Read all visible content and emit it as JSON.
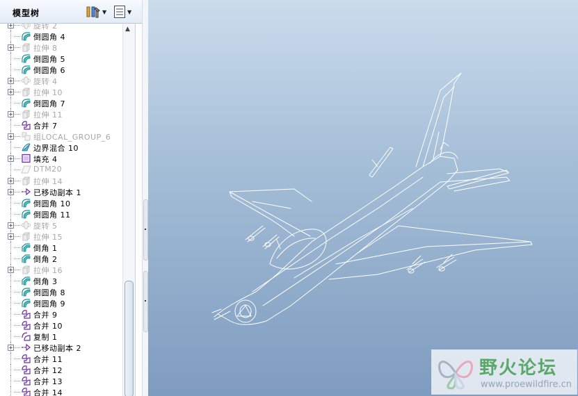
{
  "panel": {
    "title": "模型树",
    "settings_icon": "tree-settings-icon",
    "show_icon": "show-options-icon"
  },
  "tree": {
    "items": [
      {
        "label": "旋转 2",
        "icon": "revolve",
        "suppressed": true,
        "expander": "+"
      },
      {
        "label": "倒圆角 4",
        "icon": "round",
        "suppressed": false,
        "expander": ""
      },
      {
        "label": "拉伸 8",
        "icon": "extrude",
        "suppressed": true,
        "expander": "+"
      },
      {
        "label": "倒圆角 5",
        "icon": "round",
        "suppressed": false,
        "expander": ""
      },
      {
        "label": "倒圆角 6",
        "icon": "round",
        "suppressed": false,
        "expander": ""
      },
      {
        "label": "旋转 4",
        "icon": "revolve",
        "suppressed": true,
        "expander": "+"
      },
      {
        "label": "拉伸 10",
        "icon": "extrude",
        "suppressed": true,
        "expander": "+"
      },
      {
        "label": "倒圆角 7",
        "icon": "round",
        "suppressed": false,
        "expander": ""
      },
      {
        "label": "拉伸 11",
        "icon": "extrude",
        "suppressed": true,
        "expander": "+"
      },
      {
        "label": "合并 7",
        "icon": "merge",
        "suppressed": false,
        "expander": ""
      },
      {
        "label": "组LOCAL_GROUP_6",
        "icon": "group",
        "suppressed": true,
        "expander": "+"
      },
      {
        "label": "边界混合 10",
        "icon": "boundary-blend",
        "suppressed": false,
        "expander": ""
      },
      {
        "label": "填充 4",
        "icon": "fill",
        "suppressed": false,
        "expander": "+"
      },
      {
        "label": "DTM20",
        "icon": "datum-plane",
        "suppressed": true,
        "expander": ""
      },
      {
        "label": "拉伸 14",
        "icon": "extrude",
        "suppressed": true,
        "expander": "+"
      },
      {
        "label": "已移动副本 1",
        "icon": "moved-copy",
        "suppressed": false,
        "expander": "+"
      },
      {
        "label": "倒圆角 10",
        "icon": "round",
        "suppressed": false,
        "expander": ""
      },
      {
        "label": "倒圆角 11",
        "icon": "round",
        "suppressed": false,
        "expander": ""
      },
      {
        "label": "旋转 5",
        "icon": "revolve",
        "suppressed": true,
        "expander": "+"
      },
      {
        "label": "拉伸 15",
        "icon": "extrude",
        "suppressed": true,
        "expander": "+"
      },
      {
        "label": "倒角 1",
        "icon": "chamfer",
        "suppressed": false,
        "expander": ""
      },
      {
        "label": "倒角 2",
        "icon": "chamfer",
        "suppressed": false,
        "expander": ""
      },
      {
        "label": "拉伸 16",
        "icon": "extrude",
        "suppressed": true,
        "expander": "+"
      },
      {
        "label": "倒角 3",
        "icon": "chamfer",
        "suppressed": false,
        "expander": ""
      },
      {
        "label": "倒圆角 8",
        "icon": "round",
        "suppressed": false,
        "expander": ""
      },
      {
        "label": "倒圆角 9",
        "icon": "round",
        "suppressed": false,
        "expander": ""
      },
      {
        "label": "合并 9",
        "icon": "merge",
        "suppressed": false,
        "expander": ""
      },
      {
        "label": "合并 10",
        "icon": "merge",
        "suppressed": false,
        "expander": ""
      },
      {
        "label": "复制 1",
        "icon": "copy",
        "suppressed": false,
        "expander": ""
      },
      {
        "label": "已移动副本 2",
        "icon": "moved-copy",
        "suppressed": false,
        "expander": "+"
      },
      {
        "label": "合并 11",
        "icon": "merge",
        "suppressed": false,
        "expander": ""
      },
      {
        "label": "合并 12",
        "icon": "merge",
        "suppressed": false,
        "expander": ""
      },
      {
        "label": "合并 13",
        "icon": "merge",
        "suppressed": false,
        "expander": ""
      },
      {
        "label": "合并 14",
        "icon": "merge",
        "suppressed": false,
        "expander": ""
      }
    ]
  },
  "viewport": {
    "model": "jet-fighter-wireframe"
  },
  "watermark": {
    "title": "野火论坛",
    "url": "www.proewildfire.cn"
  },
  "colors": {
    "tree_connector": "#8a94a6",
    "suppressed_text": "#a8a8a8",
    "round_icon": "#1aa3a3",
    "merge_icon": "#6a2aa8",
    "viewport_top": "#cbdcec",
    "viewport_bottom": "#7e9cc0",
    "wireframe": "#ffffff"
  }
}
